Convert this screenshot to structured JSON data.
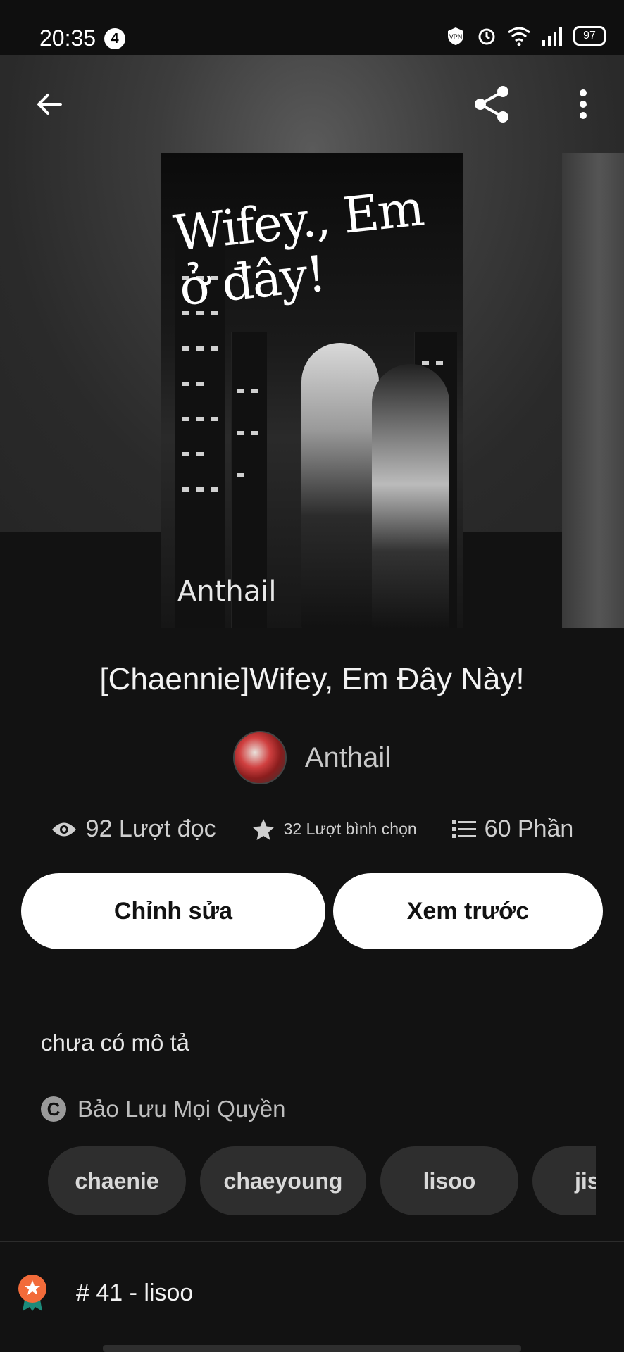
{
  "status_bar": {
    "time": "20:35",
    "notification_count": "4",
    "battery": "97"
  },
  "header": {
    "back_icon": "arrow-left-icon",
    "share_icon": "share-icon",
    "more_icon": "more-vertical-icon"
  },
  "cover": {
    "title_line1": "Wifey.,",
    "title_line2": "Em ở đây!",
    "author_signature": "Anthail"
  },
  "story": {
    "title": "[Chaennie]Wifey, Em Đây Này!"
  },
  "author": {
    "name": "Anthail"
  },
  "stats": {
    "reads": "92 Lượt đọc",
    "votes": "32 Lượt bình chọn",
    "parts": "60 Phần"
  },
  "actions": {
    "edit_label": "Chỉnh sửa",
    "preview_label": "Xem trước"
  },
  "description": "chưa có mô tả",
  "copyright": "Bảo Lưu Mọi Quyền",
  "tags": [
    "chaenie",
    "chaeyoung",
    "lisoo",
    "jis"
  ],
  "ranking": {
    "text": "# 41 - lisoo"
  },
  "colors": {
    "background": "#121212",
    "button": "#ffffff",
    "tag": "#2e2e2e",
    "badge": "#f26b3a"
  }
}
